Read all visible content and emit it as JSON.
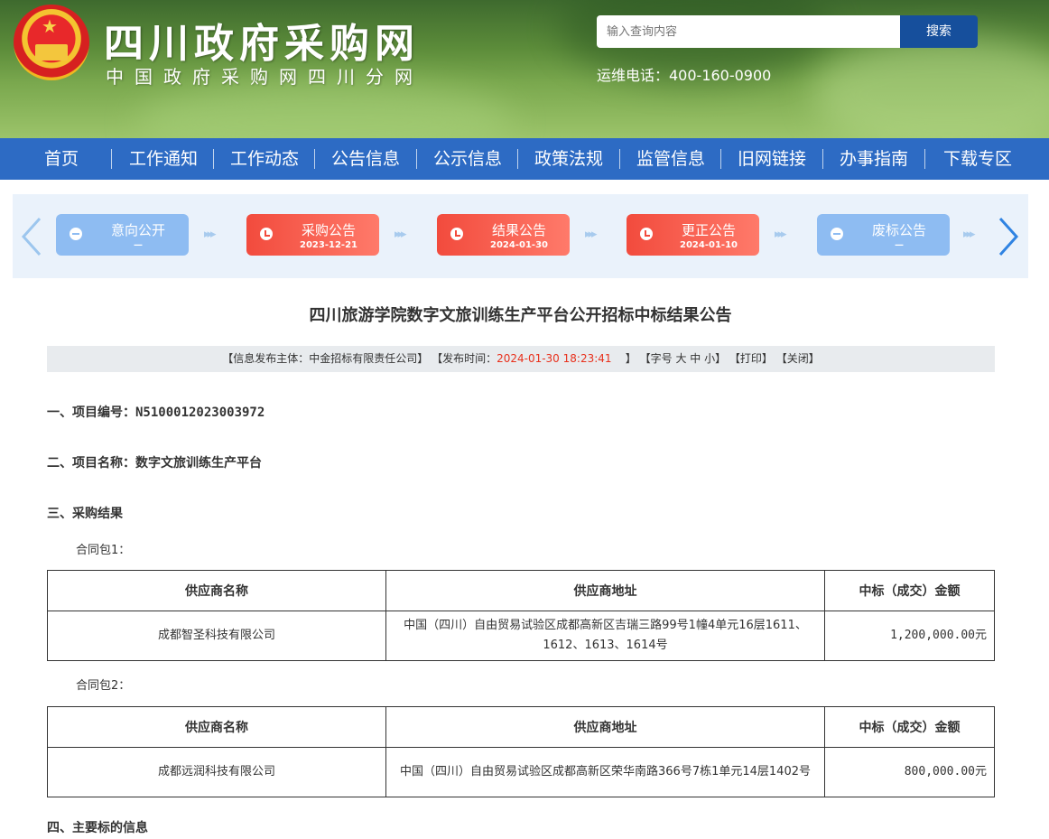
{
  "header": {
    "site_title": "四川政府采购网",
    "site_subtitle": "中国政府采购网四川分网",
    "search_placeholder": "输入查询内容",
    "search_button": "搜索",
    "hotline": "运维电话：400-160-0900",
    "emblem_icon": "national-emblem"
  },
  "nav": [
    "首页",
    "工作通知",
    "工作动态",
    "公告信息",
    "公示信息",
    "政策法规",
    "监管信息",
    "旧网链接",
    "办事指南",
    "下载专区"
  ],
  "flow": {
    "steps": [
      {
        "label": "意向公开",
        "date": "—",
        "state": "inactive"
      },
      {
        "label": "采购公告",
        "date": "2023-12-21",
        "state": "active"
      },
      {
        "label": "结果公告",
        "date": "2024-01-30",
        "state": "active"
      },
      {
        "label": "更正公告",
        "date": "2024-01-10",
        "state": "active"
      },
      {
        "label": "废标公告",
        "date": "—",
        "state": "inactive"
      }
    ],
    "colors": {
      "active": "#f24b3d",
      "inactive": "#8ebcf2"
    }
  },
  "article": {
    "title": "四川旅游学院数字文旅训练生产平台公开招标中标结果公告",
    "meta": {
      "publisher": "【信息发布主体：中金招标有限责任公司】",
      "time_label": "【发布时间：",
      "time_value": "2024-01-30 18:23:41",
      "time_end": "】",
      "font_size": "【字号 大 中 小】",
      "print": "【打印】",
      "close": "【关闭】"
    },
    "sections": {
      "s1_label": "一、项目编号：",
      "s1_value": "N5100012023003972",
      "s2": "二、项目名称：数字文旅训练生产平台",
      "s3": "三、采购结果",
      "s4": "四、主要标的信息"
    },
    "table_headers": [
      "供应商名称",
      "供应商地址",
      "中标（成交）金额"
    ],
    "packages": [
      {
        "label": "合同包1：",
        "supplier": "成都智圣科技有限公司",
        "address": "中国（四川）自由贸易试验区成都高新区吉瑞三路99号1幢4单元16层1611、1612、1613、1614号",
        "amount": "1,200,000.00元"
      },
      {
        "label": "合同包2：",
        "supplier": "成都远润科技有限公司",
        "address": "中国（四川）自由贸易试验区成都高新区荣华南路366号7栋1单元14层1402号",
        "amount": "800,000.00元"
      }
    ]
  }
}
